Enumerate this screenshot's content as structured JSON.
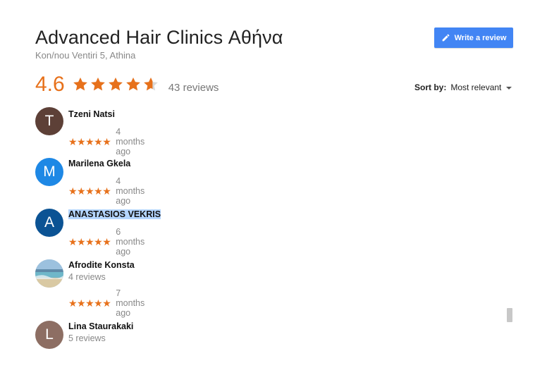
{
  "place": {
    "title": "Advanced Hair Clinics Αθήνα",
    "address": "Kon/nou Ventiri 5, Athina"
  },
  "actions": {
    "write_review": "Write a review"
  },
  "rating": {
    "score": "4.6",
    "value": 4.6,
    "max": 5,
    "count_text": "43 reviews"
  },
  "sort": {
    "label": "Sort by:",
    "value": "Most relevant"
  },
  "colors": {
    "star": "#e7711b",
    "accent": "#4285f4",
    "selection": "#b4d5fe"
  },
  "reviews": [
    {
      "initial": "T",
      "avatar_color": "#5d4037",
      "name": "Tzeni Natsi",
      "stars": "★★★★★",
      "time": "4 months ago"
    },
    {
      "initial": "M",
      "avatar_color": "#1e88e5",
      "name": "Marilena Gkela",
      "stars": "★★★★★",
      "time": "4 months ago"
    },
    {
      "initial": "A",
      "avatar_color": "#0b5394",
      "name": "ANASTASIOS VEKRIS",
      "stars": "★★★★★",
      "time": "6 months ago"
    },
    {
      "initial": "",
      "avatar_color": "#8fb3cc",
      "avatar_icon": "beach-photo",
      "name": "Afrodite Konsta",
      "count": "4 reviews",
      "stars": "★★★★★",
      "time": "7 months ago"
    },
    {
      "initial": "L",
      "avatar_color": "#8d6e63",
      "name": "Lina Staurakaki",
      "count": "5 reviews"
    }
  ]
}
